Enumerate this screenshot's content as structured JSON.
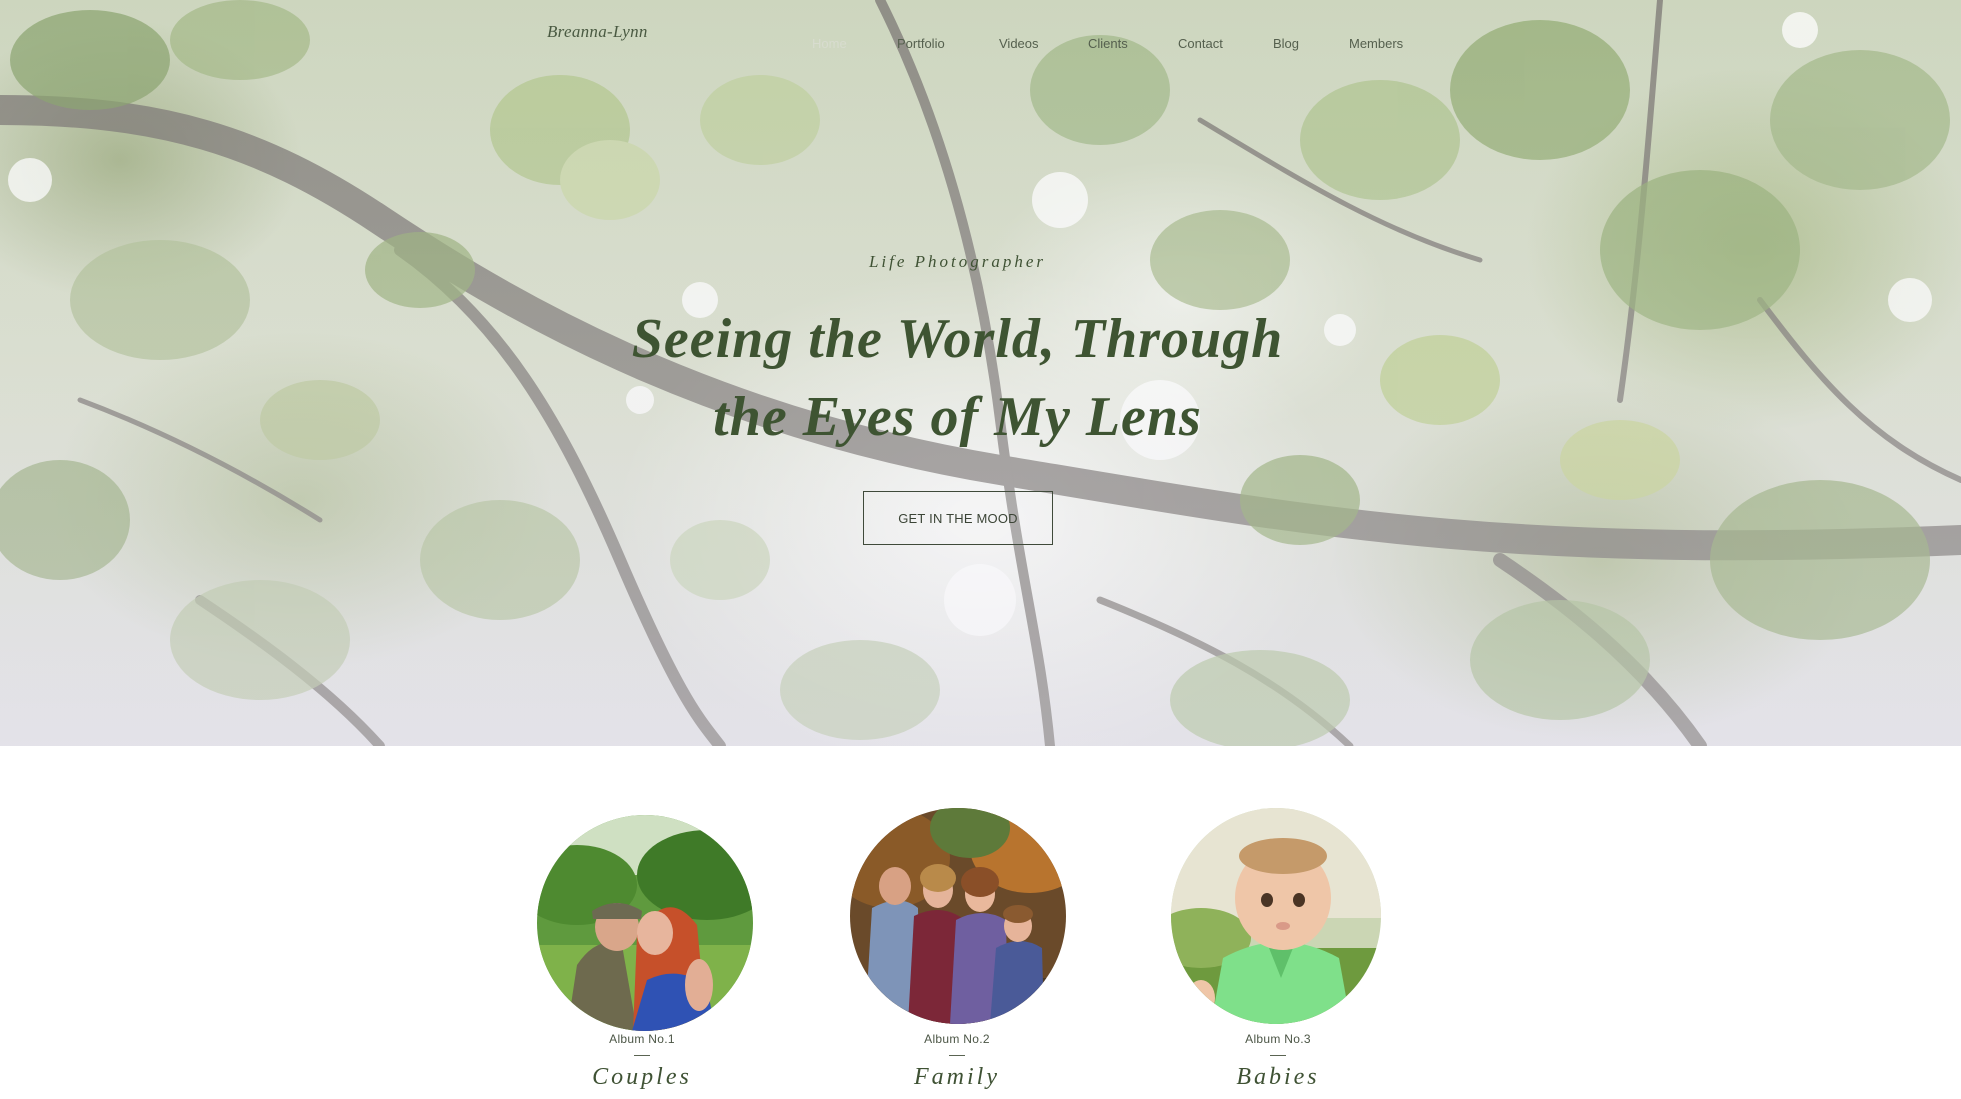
{
  "site": {
    "logo": "Breanna-Lynn"
  },
  "nav": {
    "items": [
      {
        "label": "Home",
        "active": true
      },
      {
        "label": "Portfolio",
        "active": false
      },
      {
        "label": "Videos",
        "active": false
      },
      {
        "label": "Clients",
        "active": false
      },
      {
        "label": "Contact",
        "active": false
      },
      {
        "label": "Blog",
        "active": false
      },
      {
        "label": "Members",
        "active": false
      }
    ]
  },
  "hero": {
    "subtitle": "Life Photographer",
    "headline_line1": "Seeing the World, Through",
    "headline_line2": "the Eyes of My Lens",
    "cta_label": "GET IN THE MOOD",
    "background_image": "sunlit-leaves-photo"
  },
  "albums": [
    {
      "label": "Album No.1",
      "title": "Couples",
      "photo": "couple-kissing-photo"
    },
    {
      "label": "Album No.2",
      "title": "Family",
      "photo": "family-portrait-photo"
    },
    {
      "label": "Album No.3",
      "title": "Babies",
      "photo": "baby-portrait-photo"
    }
  ],
  "colors": {
    "accent_green": "#3e5432",
    "nav_text": "#55604e",
    "nav_active": "#d8dccf",
    "background": "#ffffff"
  }
}
